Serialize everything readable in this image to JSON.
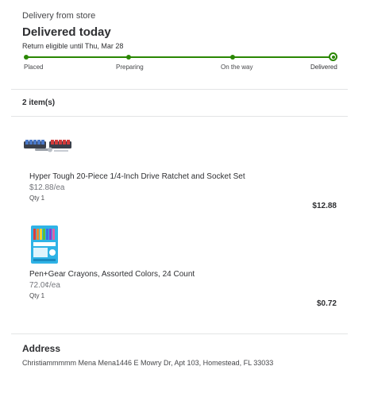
{
  "header": {
    "delivery_mode": "Delivery from store",
    "status": "Delivered today",
    "return_note": "Return eligible until Thu, Mar 28"
  },
  "tracker": {
    "steps": [
      "Placed",
      "Preparing",
      "On the way",
      "Delivered"
    ],
    "current_step": "Delivered",
    "color": "#2a8703"
  },
  "items": {
    "count_label": "2 item(s)",
    "list": [
      {
        "name": "Hyper Tough 20-Piece 1/4-Inch Drive Ratchet and Socket Set",
        "unit_price": "$12.88/ea",
        "qty": "Qty 1",
        "total": "$12.88",
        "icon": "socket-set-image"
      },
      {
        "name": "Pen+Gear Crayons, Assorted Colors, 24 Count",
        "unit_price": "72.0¢/ea",
        "qty": "Qty 1",
        "total": "$0.72",
        "icon": "crayons-box-image"
      }
    ]
  },
  "address": {
    "title": "Address",
    "text": "Christiammmmm Mena Mena1446 E Mowry Dr, Apt 103, Homestead, FL 33033"
  }
}
